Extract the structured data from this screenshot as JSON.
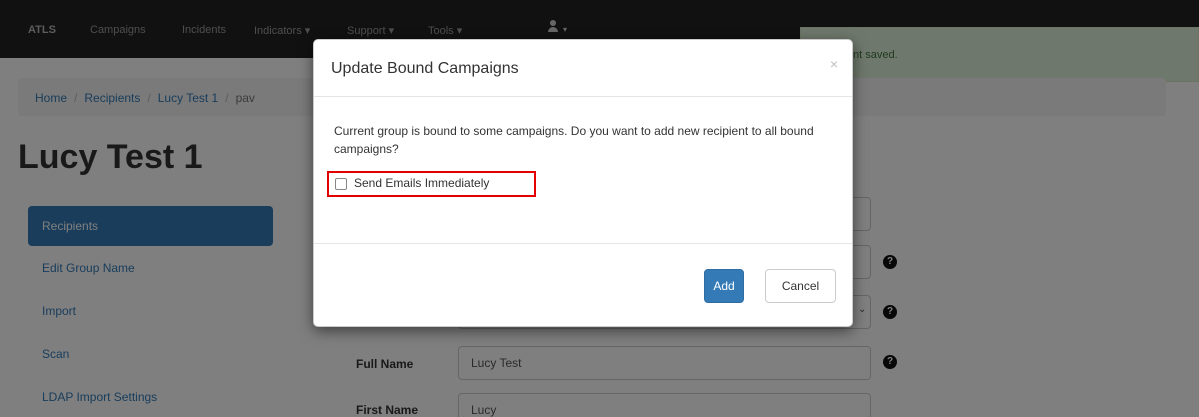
{
  "navbar": {
    "brand": "ATLS",
    "items": [
      "Campaigns",
      "Incidents",
      "Indicators ▾",
      "Support ▾",
      "Tools ▾"
    ],
    "user_caret": "▾"
  },
  "alert": {
    "text": "nt saved."
  },
  "breadcrumb": {
    "items": [
      "Home",
      "Recipients",
      "Lucy Test 1"
    ],
    "active": "pav",
    "separator": "/"
  },
  "page_title": "Lucy Test 1",
  "sidebar": {
    "items": [
      "Recipients",
      "Edit Group Name",
      "Import",
      "Scan",
      "LDAP Import Settings"
    ]
  },
  "form": {
    "full_name_label": "Full Name",
    "full_name_value": "Lucy Test",
    "first_name_label": "First Name",
    "first_name_value": "Lucy",
    "help_glyph": "?",
    "select_caret": "⌄"
  },
  "modal": {
    "title": "Update Bound Campaigns",
    "close_glyph": "×",
    "body_text": "Current group is bound to some campaigns. Do you want to add new recipient to all bound campaigns?",
    "checkbox_label": "Send Emails Immediately",
    "checkbox_checked": false,
    "add_label": "Add",
    "cancel_label": "Cancel"
  },
  "colors": {
    "primary": "#337ab7",
    "highlight": "#e50000",
    "alert_bg": "#dff0d8",
    "navbar_bg": "#222222"
  }
}
